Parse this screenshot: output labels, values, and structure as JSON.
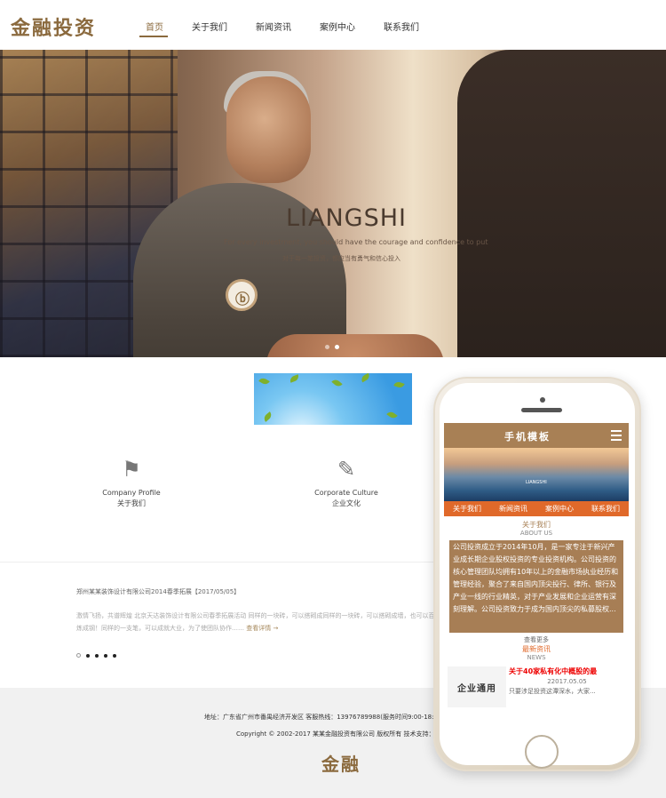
{
  "header": {
    "logo": "金融投资",
    "nav": [
      "首页",
      "关于我们",
      "新闻资讯",
      "案例中心",
      "联系我们"
    ]
  },
  "banner": {
    "title": "LIANGSHI",
    "subtitle_en": "For every investment, you should have the courage and confidence to put",
    "subtitle_cn": "对于每一笔投资，都应当有勇气和信心投入",
    "pin_icon": "ⓑ",
    "slide_index": 2,
    "slide_count": 2
  },
  "features": [
    {
      "icon": "flag-icon",
      "en": "Company Profile",
      "cn": "关于我们"
    },
    {
      "icon": "pen-tool-icon",
      "en": "Corporate Culture",
      "cn": "企业文化"
    }
  ],
  "news": {
    "title": "郑州某某装饰设计有限公司2014春季拓展【2017/05/05】",
    "desc": "激情飞扬，共谱辉煌  北京天达装饰设计有限公司春季拓展活动  同样的一块砖，可以搭砌成同样的一块砖，可以搭砌成墙，也可以百炼成钢！同样的一支笔，可以成就大业，为了使团队协作……",
    "more": "查看详情 →",
    "pager_count": 5,
    "pager_active": 1
  },
  "footer": {
    "address": "地址：广东省广州市番禺经济开发区  客服热线：13976789988(服务时间9:00-18:00)",
    "copyright": "Copyright © 2002-2017 某某金融投资有限公司 版权所有 技术支持：",
    "logo": "金融"
  },
  "mobile": {
    "title": "手机模板",
    "banner_text": "LIANGSHI",
    "nav": [
      "关于我们",
      "新闻资讯",
      "案例中心",
      "联系我们"
    ],
    "about_cn": "关于我们",
    "about_en": "ABOUT US",
    "about_text": "公司投资成立于2014年10月，是一家专注于新兴产业成长期企业股权投资的专业投资机构。公司投资的核心管理团队均拥有10年以上的金融市场执业经历和管理经验，聚合了来自国内顶尖投行、律所、银行及产业一线的行业精英，对于产业发展和企业运营有深刻理解。公司投资致力于成为国内顶尖的私募股权...",
    "more": "查看更多",
    "news_cn": "最新资讯",
    "news_en": "NEWS",
    "news_img": "企业通用",
    "news_title": "关于40家私有化中概股的最",
    "news_date": "22017.05.05",
    "news_desc": "只要涉足投资这潭深水，大家..."
  },
  "colors": {
    "brand": "#8b6a3e",
    "mobile_accent": "#e0692a",
    "mobile_header": "#a88055"
  }
}
